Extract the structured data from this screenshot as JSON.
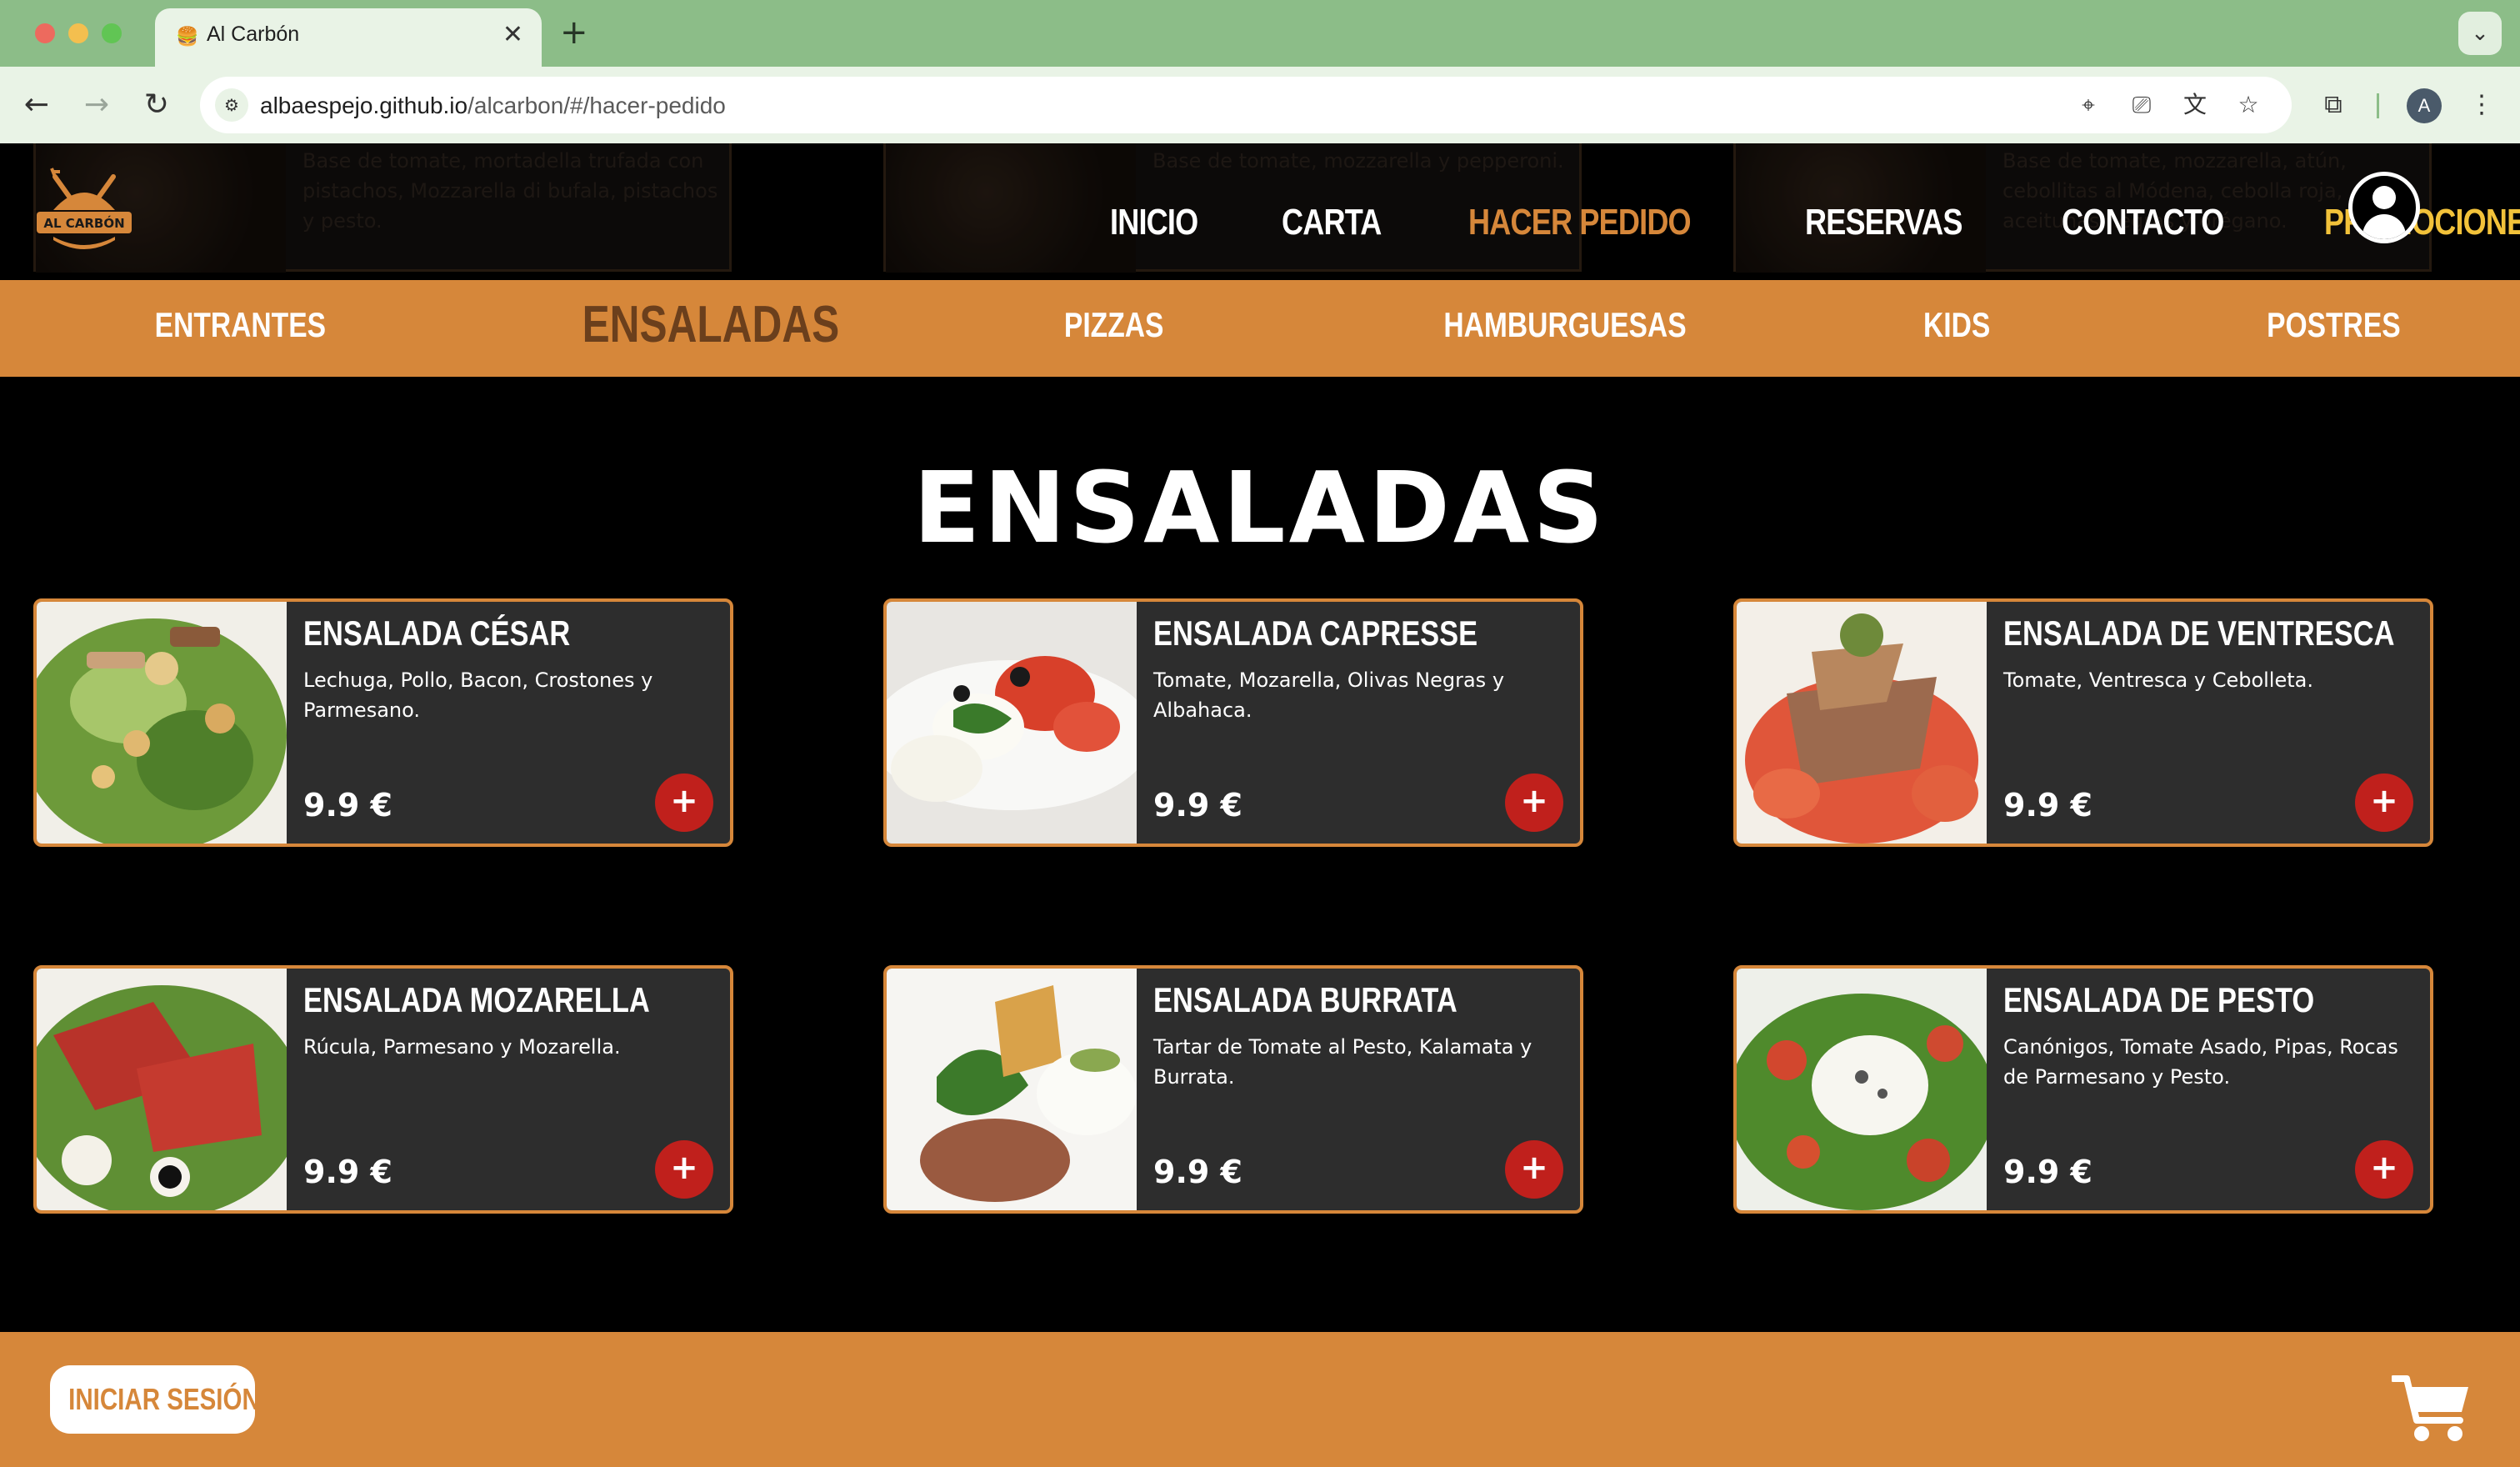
{
  "browser": {
    "tab_title": "Al Carbón",
    "tab_close": "✕",
    "new_tab": "+",
    "url_host": "albaespejo.github.io",
    "url_path": "/alcarbon/#/hacer-pedido",
    "profile_initial": "A"
  },
  "header": {
    "logo_text": "AL CARBÓN",
    "nav": [
      {
        "label": "INICIO"
      },
      {
        "label": "CARTA"
      },
      {
        "label": "HACER PEDIDO"
      },
      {
        "label": "RESERVAS"
      },
      {
        "label": "CONTACTO"
      },
      {
        "label": "PROMOCIONES"
      }
    ],
    "background_cards": [
      {
        "desc": "Base de tomate, mortadella trufada con pistachos, Mozzarella di bufala, pistachos y pesto."
      },
      {
        "desc": "Base de tomate, mozzarella y pepperoni."
      },
      {
        "desc": "Base de tomate, mozzarella, atún, cebollitas al Módena, cebolla roja, aceitunas negras y orégano."
      }
    ]
  },
  "categories": [
    {
      "label": "ENTRANTES"
    },
    {
      "label": "ENSALADAS"
    },
    {
      "label": "PIZZAS"
    },
    {
      "label": "HAMBURGUESAS"
    },
    {
      "label": "KIDS"
    },
    {
      "label": "POSTRES"
    }
  ],
  "section": {
    "title": "ENSALADAS"
  },
  "products": [
    {
      "name": "ENSALADA CÉSAR",
      "desc": "Lechuga, Pollo, Bacon, Crostones y Parmesano.",
      "price": "9.9 €",
      "add": "+"
    },
    {
      "name": "ENSALADA CAPRESSE",
      "desc": "Tomate, Mozarella, Olivas Negras y Albahaca.",
      "price": "9.9 €",
      "add": "+"
    },
    {
      "name": "ENSALADA DE VENTRESCA",
      "desc": "Tomate, Ventresca y Cebolleta.",
      "price": "9.9 €",
      "add": "+"
    },
    {
      "name": "ENSALADA MOZARELLA",
      "desc": "Rúcula, Parmesano y Mozarella.",
      "price": "9.9 €",
      "add": "+"
    },
    {
      "name": "ENSALADA BURRATA",
      "desc": "Tartar de Tomate al Pesto, Kalamata y Burrata.",
      "price": "9.9 €",
      "add": "+"
    },
    {
      "name": "ENSALADA DE PESTO",
      "desc": "Canónigos, Tomate Asado, Pipas, Rocas de Parmesano y Pesto.",
      "price": "9.9 €",
      "add": "+"
    }
  ],
  "footer": {
    "login_label": "INICIAR SESIÓN"
  },
  "colors": {
    "accent": "#d6873a",
    "promo": "#f2c23a",
    "add_button": "#c0201c",
    "card_bg": "#2d2d2d",
    "browser_frame": "#8cbd88"
  },
  "icons": [
    "back-icon",
    "forward-icon",
    "reload-icon",
    "site-settings-icon",
    "location-icon",
    "install-icon",
    "translate-icon",
    "bookmark-star-icon",
    "extensions-icon",
    "menu-dots-icon",
    "user-icon",
    "cart-icon"
  ]
}
